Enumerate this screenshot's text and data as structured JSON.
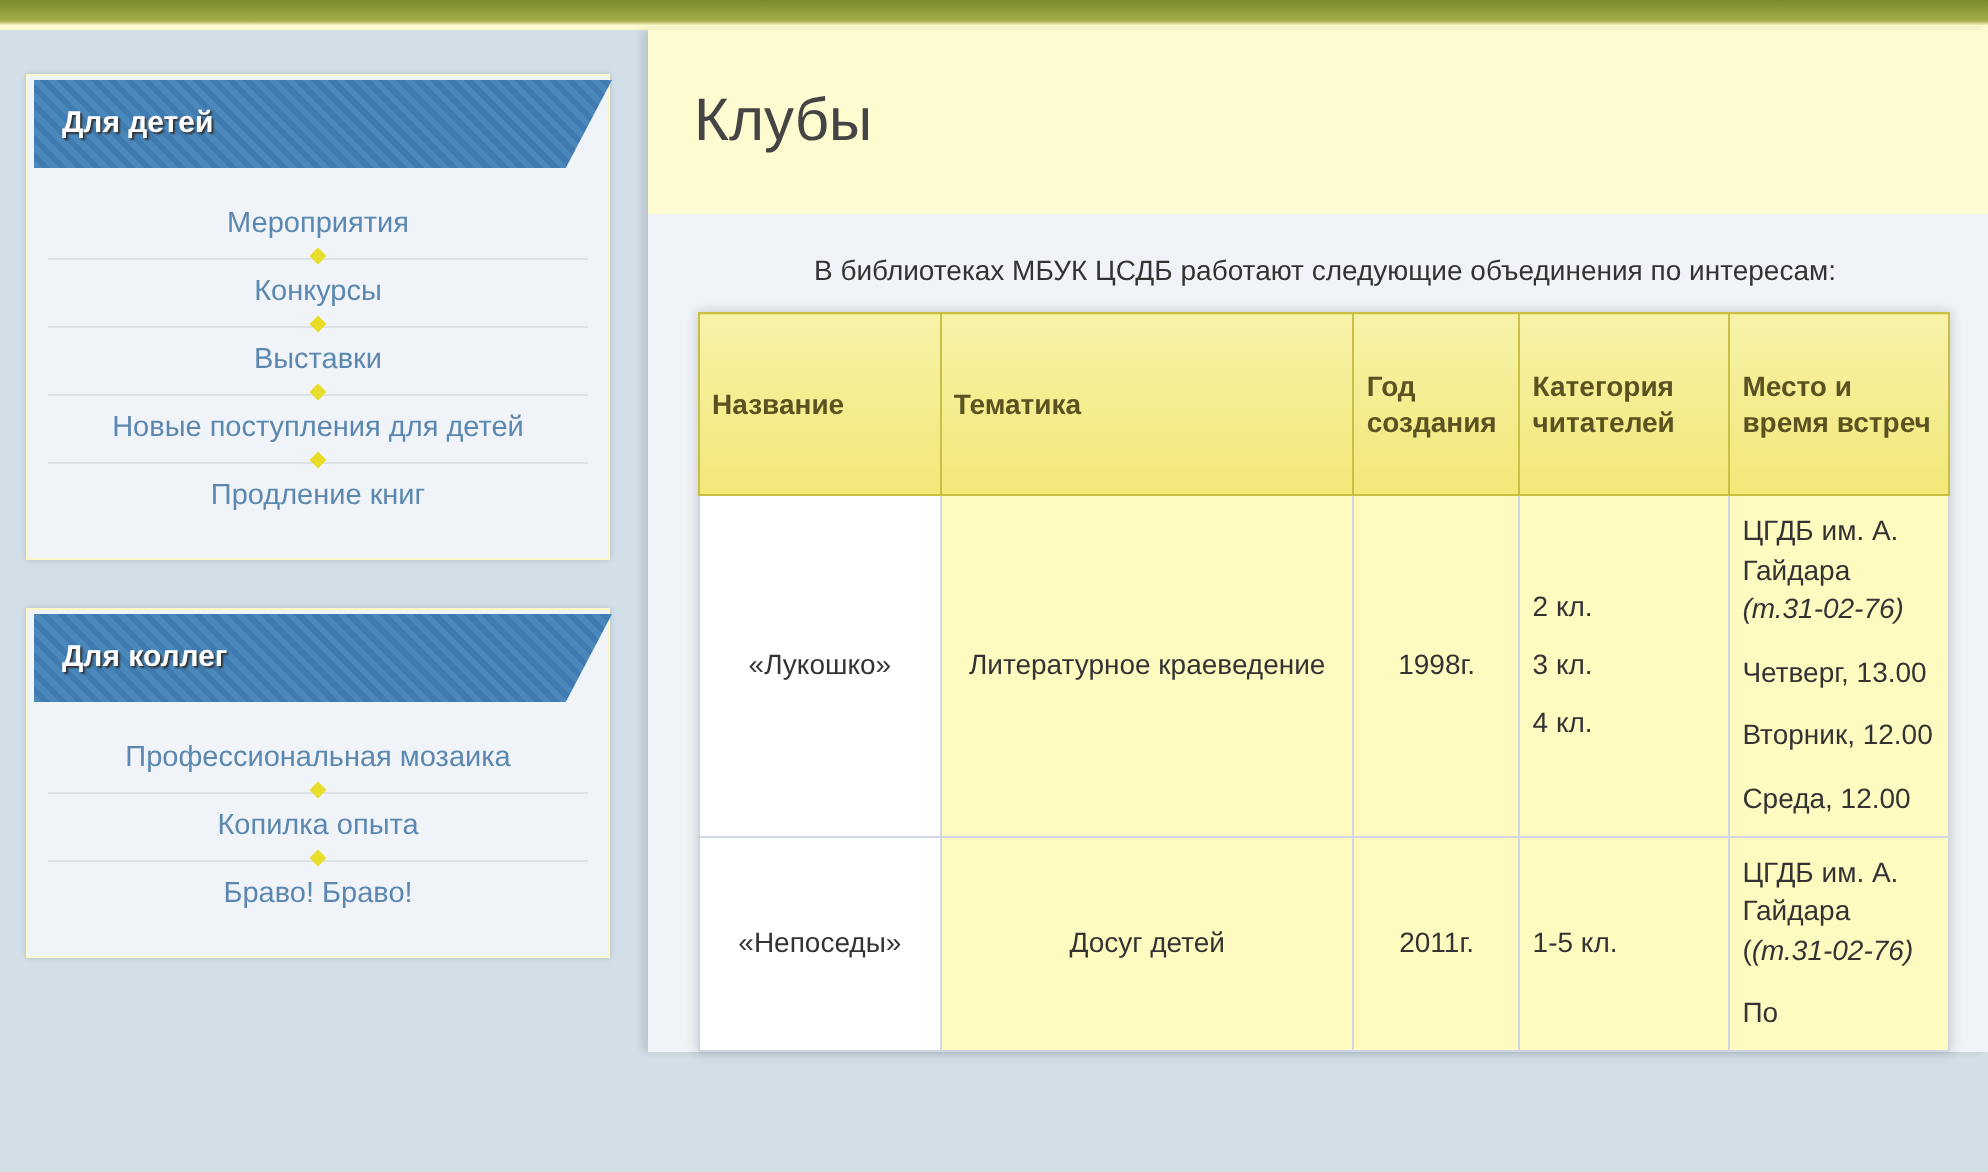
{
  "sidebar": {
    "blocks": [
      {
        "title": "Для детей",
        "items": [
          "Мероприятия",
          "Конкурсы",
          "Выставки",
          "Новые поступления для детей",
          "Продление книг"
        ]
      },
      {
        "title": "Для коллег",
        "items": [
          "Профессиональная мозаика",
          "Копилка опыта",
          "Браво! Браво!"
        ]
      }
    ]
  },
  "page": {
    "title": "Клубы",
    "intro": "В библиотеках МБУК ЦСДБ работают следующие объединения по интересам:"
  },
  "table": {
    "columns": [
      "Название",
      "Тематика",
      "Год создания",
      "Категория читателей",
      "Место и время встреч"
    ],
    "rows": [
      {
        "name": "«Лукошко»",
        "topic": "Литературное краеведение",
        "year": "1998г.",
        "categories": [
          "2 кл.",
          "3 кл.",
          "4 кл."
        ],
        "place": [
          "ЦГДБ им. А. Гайдара *(т.31-02-76)*",
          "Четверг, 13.00",
          "Вторник, 12.00",
          "Среда, 12.00"
        ]
      },
      {
        "name": "«Непоседы»",
        "topic": "Досуг детей",
        "year": "2011г.",
        "categories": [
          "1-5 кл."
        ],
        "place": [
          "ЦГДБ им. А. Гайдара (*(т.31-02-76)*",
          "По"
        ]
      }
    ]
  }
}
